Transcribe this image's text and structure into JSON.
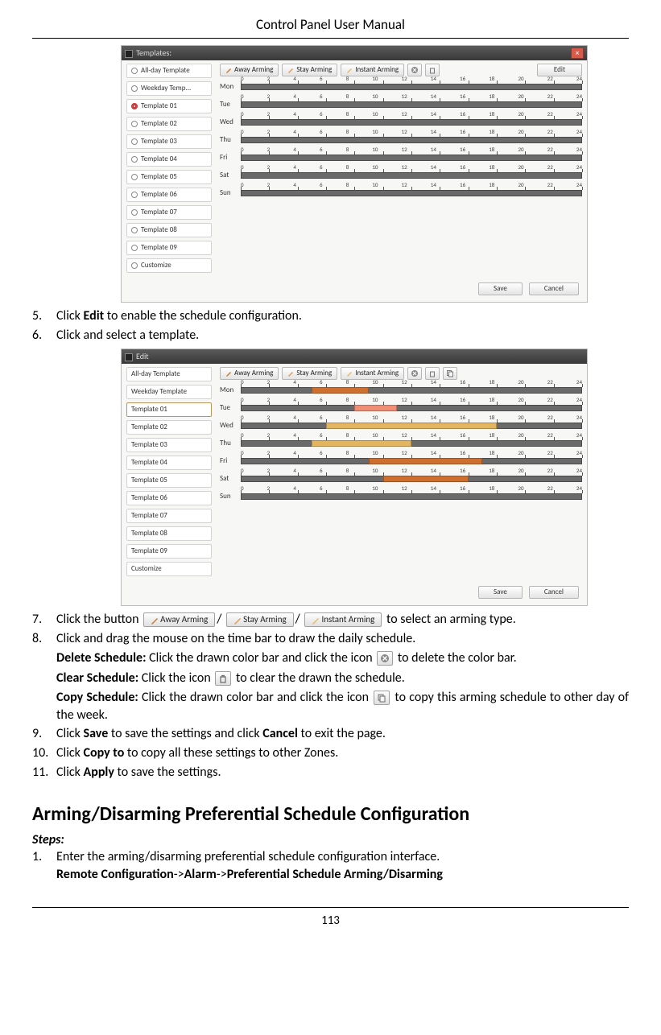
{
  "header": {
    "title": "Control Panel User Manual"
  },
  "footer": {
    "page": "113"
  },
  "screenshot1": {
    "title": "Templates:",
    "sidebar": [
      {
        "label": "All-day Template",
        "selected": false
      },
      {
        "label": "Weekday Temp...",
        "selected": false
      },
      {
        "label": "Template 01",
        "selected": true
      },
      {
        "label": "Template 02",
        "selected": false
      },
      {
        "label": "Template 03",
        "selected": false
      },
      {
        "label": "Template 04",
        "selected": false
      },
      {
        "label": "Template 05",
        "selected": false
      },
      {
        "label": "Template 06",
        "selected": false
      },
      {
        "label": "Template 07",
        "selected": false
      },
      {
        "label": "Template 08",
        "selected": false
      },
      {
        "label": "Template 09",
        "selected": false
      },
      {
        "label": "Customize",
        "selected": false
      }
    ],
    "modes": {
      "away": "Away Arming",
      "stay": "Stay Arming",
      "instant": "Instant Arming"
    },
    "edit_btn": "Edit",
    "days": [
      "Mon",
      "Tue",
      "Wed",
      "Thu",
      "Fri",
      "Sat",
      "Sun"
    ],
    "hours": [
      "0",
      "2",
      "4",
      "6",
      "8",
      "10",
      "12",
      "14",
      "16",
      "18",
      "20",
      "22",
      "24"
    ],
    "save": "Save",
    "cancel": "Cancel"
  },
  "screenshot2": {
    "title": "Edit",
    "sidebar": [
      {
        "label": "All-day Template"
      },
      {
        "label": "Weekday Template"
      },
      {
        "label": "Template 01",
        "selected": true
      },
      {
        "label": "Template 02"
      },
      {
        "label": "Template 03"
      },
      {
        "label": "Template 04"
      },
      {
        "label": "Template 05"
      },
      {
        "label": "Template 06"
      },
      {
        "label": "Template 07"
      },
      {
        "label": "Template 08"
      },
      {
        "label": "Template 09"
      },
      {
        "label": "Customize"
      }
    ],
    "modes": {
      "away": "Away Arming",
      "stay": "Stay Arming",
      "instant": "Instant Arming"
    },
    "days": [
      "Mon",
      "Tue",
      "Wed",
      "Thu",
      "Fri",
      "Sat",
      "Sun"
    ],
    "hours": [
      "0",
      "2",
      "4",
      "6",
      "8",
      "10",
      "12",
      "14",
      "16",
      "18",
      "20",
      "22",
      "24"
    ],
    "segments": {
      "Mon": [
        {
          "s": 5,
          "e": 9,
          "c": "#cf6f2f"
        }
      ],
      "Tue": [
        {
          "s": 8,
          "e": 11,
          "c": "#ef8e75"
        }
      ],
      "Wed": [
        {
          "s": 6,
          "e": 18,
          "c": "#e4b560"
        }
      ],
      "Thu": [
        {
          "s": 5,
          "e": 12,
          "c": "#e4b560"
        }
      ],
      "Fri": [
        {
          "s": 9,
          "e": 17,
          "c": "#cf6f2f"
        }
      ],
      "Sat": [
        {
          "s": 10,
          "e": 16,
          "c": "#cf6f2f"
        }
      ],
      "Sun": []
    },
    "save": "Save",
    "cancel": "Cancel"
  },
  "text": {
    "s5a": "Click ",
    "s5b": "Edit",
    "s5c": " to enable the schedule configuration.",
    "s6": "Click and select a template.",
    "s7a": "Click the button ",
    "s7slash": "/",
    "s7b": " to select an arming type.",
    "s8": "Click and drag the mouse on the time bar to draw the daily schedule.",
    "s8_del_a": "Delete Schedule:",
    "s8_del_b": " Click the drawn color bar and click the icon ",
    "s8_del_c": " to delete the color bar.",
    "s8_clr_a": "Clear Schedule:",
    "s8_clr_b": " Click the icon ",
    "s8_clr_c": " to clear the drawn the schedule.",
    "s8_cpy_a": "Copy Schedule:",
    "s8_cpy_b": " Click the drawn color bar and click the icon ",
    "s8_cpy_c": " to copy this arming schedule to other day of the week.",
    "s9a": "Click ",
    "s9b": "Save",
    "s9c": " to save the settings and click ",
    "s9d": "Cancel",
    "s9e": " to exit the page.",
    "s10a": "Click ",
    "s10b": "Copy to",
    "s10c": " to copy all these settings to other Zones.",
    "s11a": "Click ",
    "s11b": "Apply",
    "s11c": " to save the settings.",
    "h2": "Arming/Disarming Preferential Schedule Configuration",
    "steps_label": "Steps:",
    "p1": "Enter the arming/disarming preferential schedule configuration interface.",
    "p1path_a": "Remote Configuration",
    "p1path_b": "Alarm",
    "p1path_c": "Preferential Schedule Arming/Disarming",
    "arrow": "->",
    "inline_away": "Away Arming",
    "inline_stay": "Stay Arming",
    "inline_instant": "Instant Arming"
  }
}
